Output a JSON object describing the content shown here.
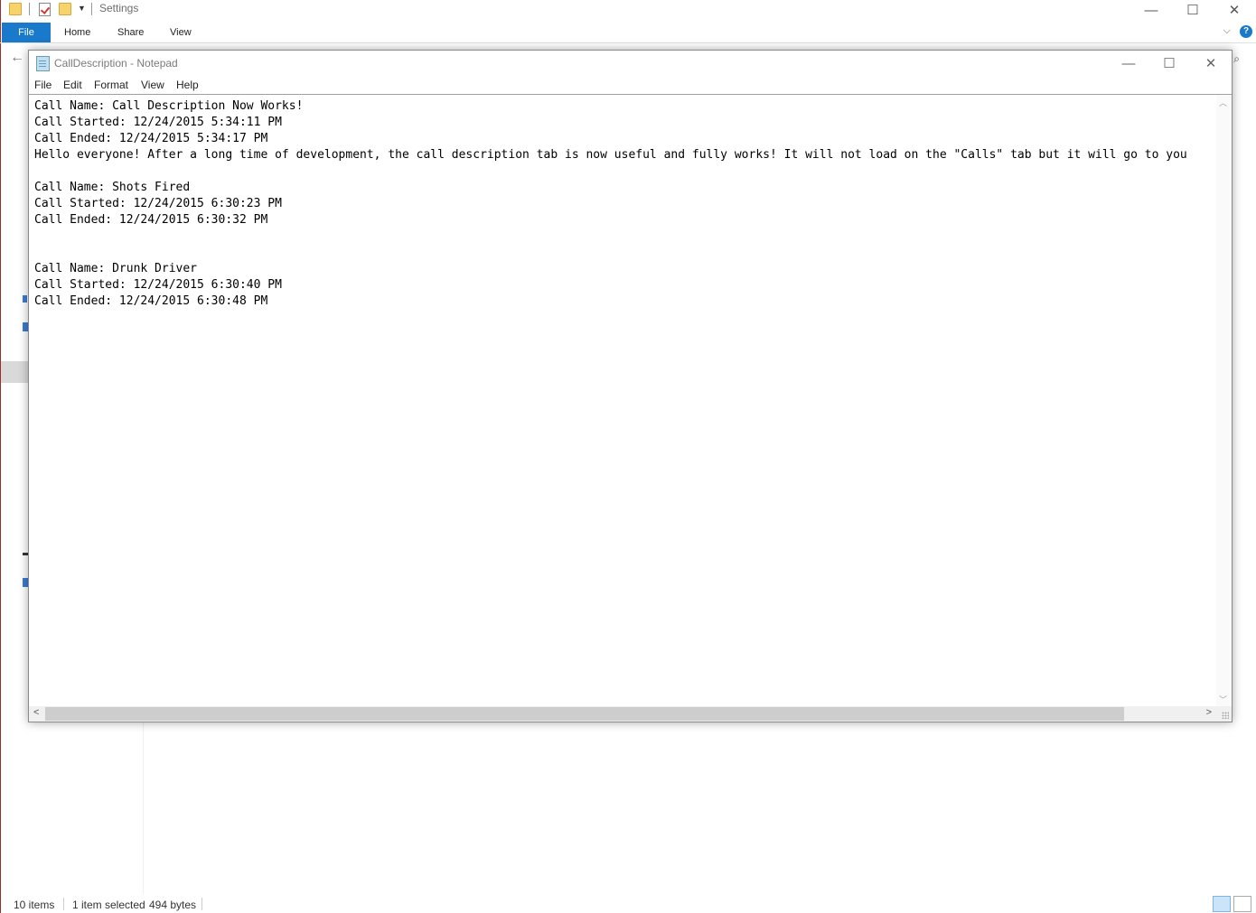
{
  "explorer": {
    "title": "Settings",
    "ribbon_tabs": [
      "File",
      "Home",
      "Share",
      "View"
    ],
    "help_label": "?",
    "status": {
      "items": "10 items",
      "selected": "1 item selected",
      "size": "494 bytes"
    }
  },
  "notepad": {
    "title": "CallDescription - Notepad",
    "menu": [
      "File",
      "Edit",
      "Format",
      "View",
      "Help"
    ],
    "content": "Call Name: Call Description Now Works!\nCall Started: 12/24/2015 5:34:11 PM\nCall Ended: 12/24/2015 5:34:17 PM\nHello everyone! After a long time of development, the call description tab is now useful and fully works! It will not load on the \"Calls\" tab but it will go to you\n\nCall Name: Shots Fired\nCall Started: 12/24/2015 6:30:23 PM\nCall Ended: 12/24/2015 6:30:32 PM\n\n\nCall Name: Drunk Driver\nCall Started: 12/24/2015 6:30:40 PM\nCall Ended: 12/24/2015 6:30:48 PM"
  },
  "icons": {
    "minimize": "—",
    "maximize": "☐",
    "close": "✕",
    "back": "←",
    "chevron": "⌵",
    "search": "⌕"
  }
}
